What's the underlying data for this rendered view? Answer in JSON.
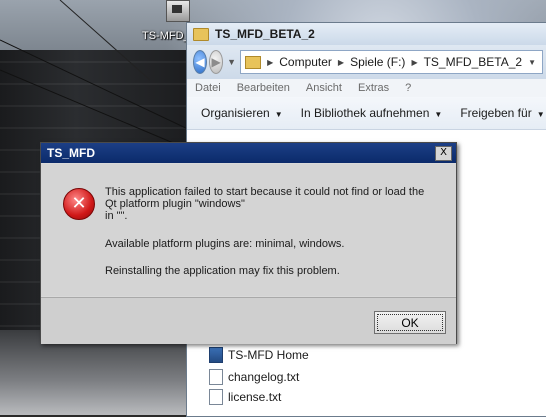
{
  "desktop": {
    "icon_label": "TS-MFD_"
  },
  "explorer": {
    "title": "TS_MFD_BETA_2",
    "breadcrumbs": [
      "Computer",
      "Spiele (F:)",
      "TS_MFD_BETA_2"
    ],
    "menu": [
      "Datei",
      "Bearbeiten",
      "Ansicht",
      "Extras",
      "?"
    ],
    "commands": [
      "Organisieren",
      "In Bibliothek aufnehmen",
      "Freigeben für"
    ],
    "files": [
      {
        "name": "TS-MFD Home",
        "icon": "app-icon"
      },
      {
        "name": "changelog.txt",
        "icon": "text-file-icon"
      },
      {
        "name": "license.txt",
        "icon": "text-file-icon"
      }
    ]
  },
  "dialog": {
    "title": "TS_MFD",
    "close_label": "X",
    "icon": "error-icon",
    "message_line1": "This application failed to start because it could not find or load the",
    "message_line2": "Qt platform plugin \"windows\"",
    "message_line3": "in \"\".",
    "message_available": "Available platform plugins are: minimal, windows.",
    "message_reinstall": "Reinstalling the application may fix this problem.",
    "ok_label": "OK"
  }
}
